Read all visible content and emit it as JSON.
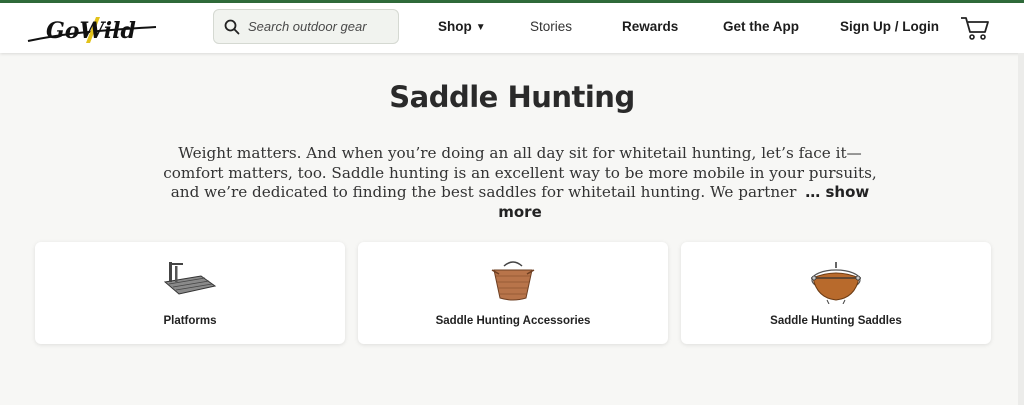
{
  "header": {
    "logo_text": "GoWild",
    "search": {
      "placeholder": "Search outdoor gear",
      "value": ""
    },
    "nav": [
      {
        "label": "Shop",
        "has_dropdown": true
      },
      {
        "label": "Stories"
      },
      {
        "label": "Rewards"
      },
      {
        "label": "Get the App"
      },
      {
        "label": "Sign Up / Login"
      }
    ],
    "cart_icon": "cart-icon"
  },
  "main": {
    "title": "Saddle Hunting",
    "description": "Weight matters. And when you’re doing an all day sit for whitetail hunting, let’s face it—comfort matters, too. Saddle hunting is an excellent way to be more mobile in your pursuits, and we’re dedicated to finding the best saddles for whitetail hunting. We partner",
    "show_more": "… show more",
    "categories": [
      {
        "label": "Platforms",
        "icon": "platform-image"
      },
      {
        "label": "Saddle Hunting Accessories",
        "icon": "accessory-bag-image"
      },
      {
        "label": "Saddle Hunting Saddles",
        "icon": "saddle-image"
      }
    ]
  },
  "colors": {
    "accent_green": "#2f6b3a",
    "logo_yellow": "#e2c21a"
  }
}
